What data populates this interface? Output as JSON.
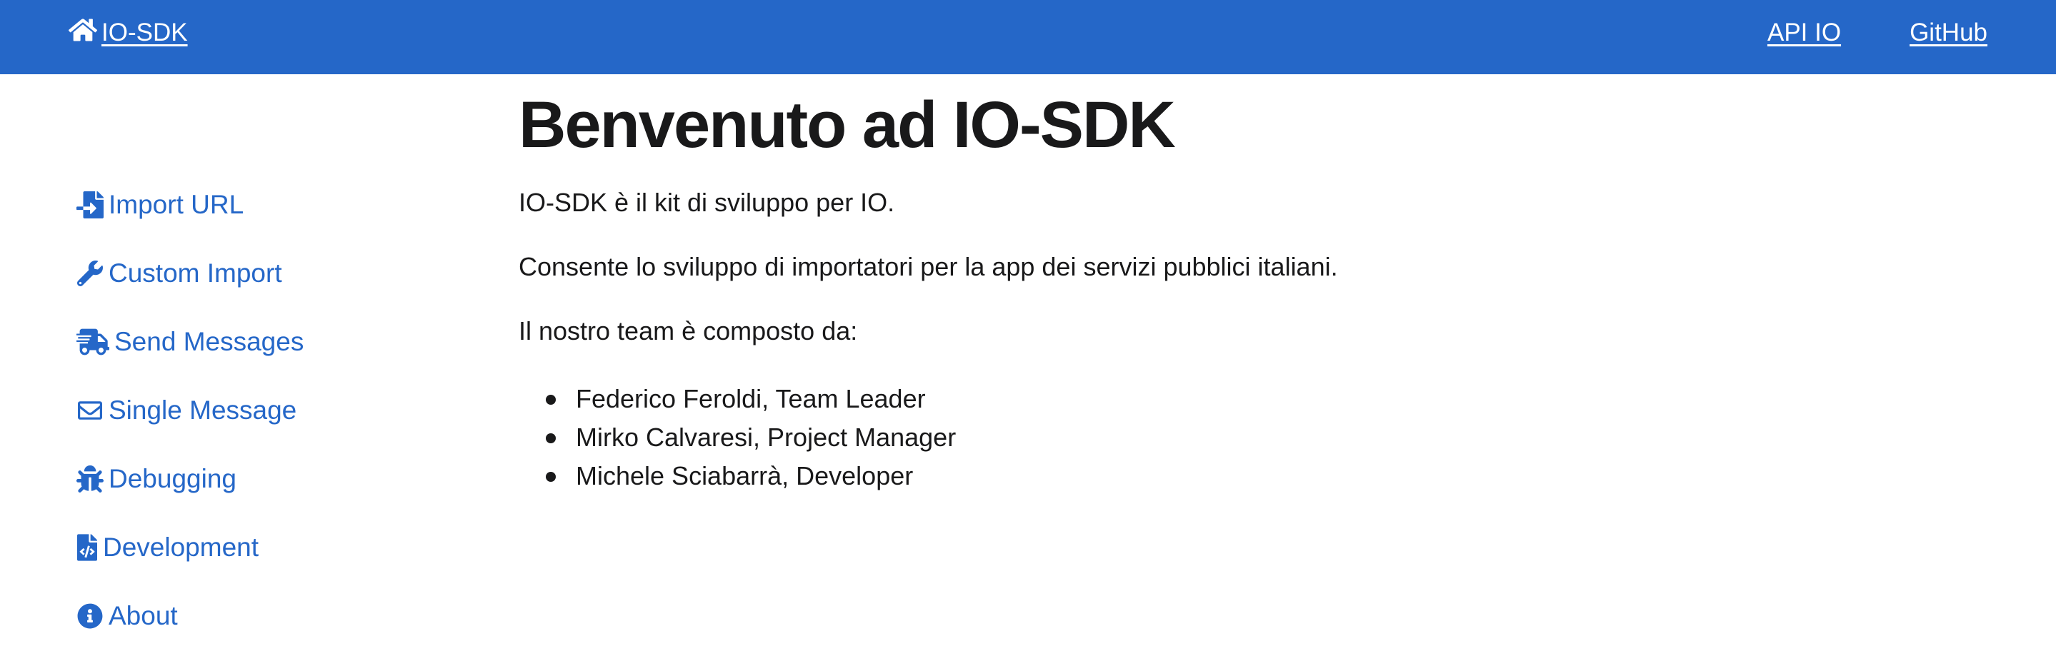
{
  "colors": {
    "navbar": "#2567c8",
    "link": "#2567c8",
    "text": "#19191a"
  },
  "navbar": {
    "brand_icon": "home-icon",
    "brand_label": "IO-SDK",
    "links": [
      {
        "label": "API IO"
      },
      {
        "label": "GitHub"
      }
    ]
  },
  "sidebar": {
    "items": [
      {
        "icon": "file-import-icon",
        "label": "Import URL"
      },
      {
        "icon": "wrench-icon",
        "label": "Custom Import"
      },
      {
        "icon": "shipping-fast-icon",
        "label": "Send Messages"
      },
      {
        "icon": "envelope-icon",
        "label": "Single Message"
      },
      {
        "icon": "bug-icon",
        "label": "Debugging"
      },
      {
        "icon": "file-code-icon",
        "label": "Development"
      },
      {
        "icon": "info-circle-icon",
        "label": "About"
      }
    ]
  },
  "main": {
    "title": "Benvenuto ad IO-SDK",
    "paragraphs": [
      "IO-SDK è il kit di sviluppo per IO.",
      "Consente lo sviluppo di importatori per la app dei servizi pubblici italiani.",
      "Il nostro team è composto da:"
    ],
    "team": [
      "Federico Feroldi, Team Leader",
      "Mirko Calvaresi, Project Manager",
      "Michele Sciabarrà, Developer"
    ]
  }
}
